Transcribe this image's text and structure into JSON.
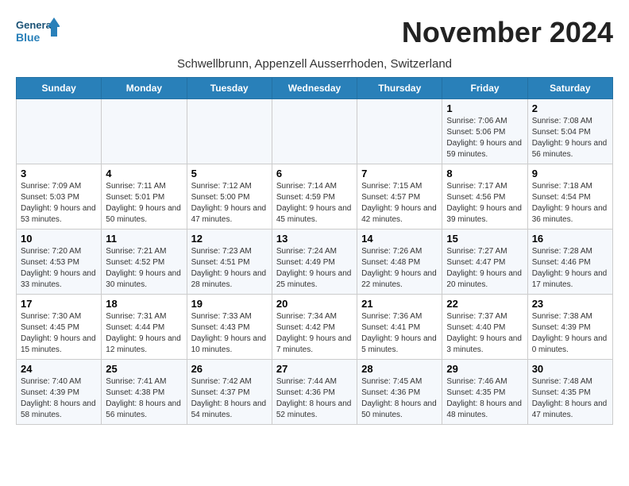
{
  "logo": {
    "line1": "General",
    "line2": "Blue"
  },
  "title": "November 2024",
  "subtitle": "Schwellbrunn, Appenzell Ausserrhoden, Switzerland",
  "headers": [
    "Sunday",
    "Monday",
    "Tuesday",
    "Wednesday",
    "Thursday",
    "Friday",
    "Saturday"
  ],
  "weeks": [
    [
      {
        "day": "",
        "sunrise": "",
        "sunset": "",
        "daylight": ""
      },
      {
        "day": "",
        "sunrise": "",
        "sunset": "",
        "daylight": ""
      },
      {
        "day": "",
        "sunrise": "",
        "sunset": "",
        "daylight": ""
      },
      {
        "day": "",
        "sunrise": "",
        "sunset": "",
        "daylight": ""
      },
      {
        "day": "",
        "sunrise": "",
        "sunset": "",
        "daylight": ""
      },
      {
        "day": "1",
        "sunrise": "Sunrise: 7:06 AM",
        "sunset": "Sunset: 5:06 PM",
        "daylight": "Daylight: 9 hours and 59 minutes."
      },
      {
        "day": "2",
        "sunrise": "Sunrise: 7:08 AM",
        "sunset": "Sunset: 5:04 PM",
        "daylight": "Daylight: 9 hours and 56 minutes."
      }
    ],
    [
      {
        "day": "3",
        "sunrise": "Sunrise: 7:09 AM",
        "sunset": "Sunset: 5:03 PM",
        "daylight": "Daylight: 9 hours and 53 minutes."
      },
      {
        "day": "4",
        "sunrise": "Sunrise: 7:11 AM",
        "sunset": "Sunset: 5:01 PM",
        "daylight": "Daylight: 9 hours and 50 minutes."
      },
      {
        "day": "5",
        "sunrise": "Sunrise: 7:12 AM",
        "sunset": "Sunset: 5:00 PM",
        "daylight": "Daylight: 9 hours and 47 minutes."
      },
      {
        "day": "6",
        "sunrise": "Sunrise: 7:14 AM",
        "sunset": "Sunset: 4:59 PM",
        "daylight": "Daylight: 9 hours and 45 minutes."
      },
      {
        "day": "7",
        "sunrise": "Sunrise: 7:15 AM",
        "sunset": "Sunset: 4:57 PM",
        "daylight": "Daylight: 9 hours and 42 minutes."
      },
      {
        "day": "8",
        "sunrise": "Sunrise: 7:17 AM",
        "sunset": "Sunset: 4:56 PM",
        "daylight": "Daylight: 9 hours and 39 minutes."
      },
      {
        "day": "9",
        "sunrise": "Sunrise: 7:18 AM",
        "sunset": "Sunset: 4:54 PM",
        "daylight": "Daylight: 9 hours and 36 minutes."
      }
    ],
    [
      {
        "day": "10",
        "sunrise": "Sunrise: 7:20 AM",
        "sunset": "Sunset: 4:53 PM",
        "daylight": "Daylight: 9 hours and 33 minutes."
      },
      {
        "day": "11",
        "sunrise": "Sunrise: 7:21 AM",
        "sunset": "Sunset: 4:52 PM",
        "daylight": "Daylight: 9 hours and 30 minutes."
      },
      {
        "day": "12",
        "sunrise": "Sunrise: 7:23 AM",
        "sunset": "Sunset: 4:51 PM",
        "daylight": "Daylight: 9 hours and 28 minutes."
      },
      {
        "day": "13",
        "sunrise": "Sunrise: 7:24 AM",
        "sunset": "Sunset: 4:49 PM",
        "daylight": "Daylight: 9 hours and 25 minutes."
      },
      {
        "day": "14",
        "sunrise": "Sunrise: 7:26 AM",
        "sunset": "Sunset: 4:48 PM",
        "daylight": "Daylight: 9 hours and 22 minutes."
      },
      {
        "day": "15",
        "sunrise": "Sunrise: 7:27 AM",
        "sunset": "Sunset: 4:47 PM",
        "daylight": "Daylight: 9 hours and 20 minutes."
      },
      {
        "day": "16",
        "sunrise": "Sunrise: 7:28 AM",
        "sunset": "Sunset: 4:46 PM",
        "daylight": "Daylight: 9 hours and 17 minutes."
      }
    ],
    [
      {
        "day": "17",
        "sunrise": "Sunrise: 7:30 AM",
        "sunset": "Sunset: 4:45 PM",
        "daylight": "Daylight: 9 hours and 15 minutes."
      },
      {
        "day": "18",
        "sunrise": "Sunrise: 7:31 AM",
        "sunset": "Sunset: 4:44 PM",
        "daylight": "Daylight: 9 hours and 12 minutes."
      },
      {
        "day": "19",
        "sunrise": "Sunrise: 7:33 AM",
        "sunset": "Sunset: 4:43 PM",
        "daylight": "Daylight: 9 hours and 10 minutes."
      },
      {
        "day": "20",
        "sunrise": "Sunrise: 7:34 AM",
        "sunset": "Sunset: 4:42 PM",
        "daylight": "Daylight: 9 hours and 7 minutes."
      },
      {
        "day": "21",
        "sunrise": "Sunrise: 7:36 AM",
        "sunset": "Sunset: 4:41 PM",
        "daylight": "Daylight: 9 hours and 5 minutes."
      },
      {
        "day": "22",
        "sunrise": "Sunrise: 7:37 AM",
        "sunset": "Sunset: 4:40 PM",
        "daylight": "Daylight: 9 hours and 3 minutes."
      },
      {
        "day": "23",
        "sunrise": "Sunrise: 7:38 AM",
        "sunset": "Sunset: 4:39 PM",
        "daylight": "Daylight: 9 hours and 0 minutes."
      }
    ],
    [
      {
        "day": "24",
        "sunrise": "Sunrise: 7:40 AM",
        "sunset": "Sunset: 4:39 PM",
        "daylight": "Daylight: 8 hours and 58 minutes."
      },
      {
        "day": "25",
        "sunrise": "Sunrise: 7:41 AM",
        "sunset": "Sunset: 4:38 PM",
        "daylight": "Daylight: 8 hours and 56 minutes."
      },
      {
        "day": "26",
        "sunrise": "Sunrise: 7:42 AM",
        "sunset": "Sunset: 4:37 PM",
        "daylight": "Daylight: 8 hours and 54 minutes."
      },
      {
        "day": "27",
        "sunrise": "Sunrise: 7:44 AM",
        "sunset": "Sunset: 4:36 PM",
        "daylight": "Daylight: 8 hours and 52 minutes."
      },
      {
        "day": "28",
        "sunrise": "Sunrise: 7:45 AM",
        "sunset": "Sunset: 4:36 PM",
        "daylight": "Daylight: 8 hours and 50 minutes."
      },
      {
        "day": "29",
        "sunrise": "Sunrise: 7:46 AM",
        "sunset": "Sunset: 4:35 PM",
        "daylight": "Daylight: 8 hours and 48 minutes."
      },
      {
        "day": "30",
        "sunrise": "Sunrise: 7:48 AM",
        "sunset": "Sunset: 4:35 PM",
        "daylight": "Daylight: 8 hours and 47 minutes."
      }
    ]
  ]
}
